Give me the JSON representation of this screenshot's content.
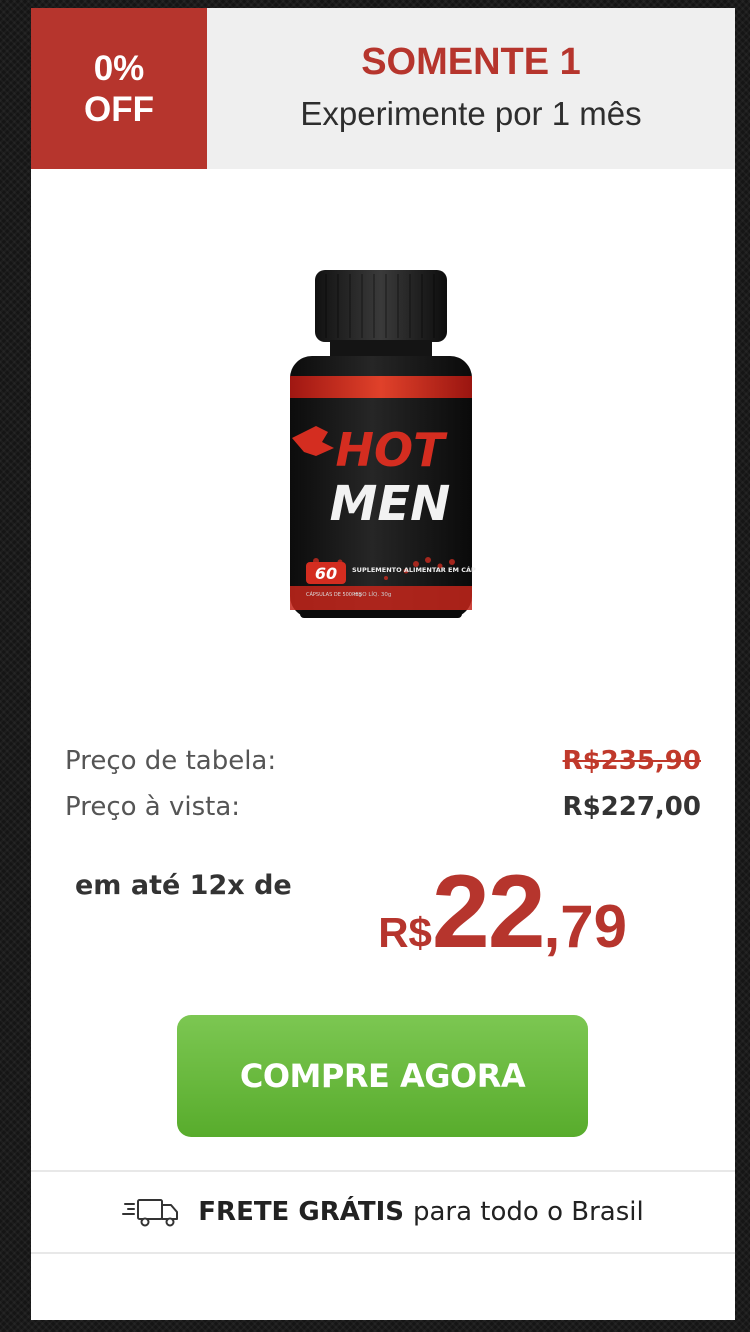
{
  "offer": {
    "discount_line1": "0%",
    "discount_line2": "OFF",
    "title": "SOMENTE 1",
    "subtitle": "Experimente por 1 mês"
  },
  "product": {
    "brand_line1": "HOT",
    "brand_line2": "MEN",
    "capsule_count": "60",
    "capsule_caption": "CÁPSULAS DE 500 mg",
    "description": "SUPLEMENTO ALIMENTAR EM CÁPSULAS",
    "net_weight": "PESO LÍQ. 30g"
  },
  "pricing": {
    "list_label": "Preço de tabela:",
    "list_value": "R$235,90",
    "cash_label": "Preço à vista:",
    "cash_value": "R$227,00",
    "installments_label": "em até 12x de",
    "installment_currency": "R$",
    "installment_int": "22",
    "installment_cents": ",79"
  },
  "cta": {
    "label": "COMPRE AGORA"
  },
  "shipping": {
    "bold": "FRETE GRÁTIS",
    "text": "para todo o Brasil",
    "icon": "truck-icon"
  },
  "colors": {
    "accent": "#b6352d",
    "button": "#6bbb3f",
    "header_bg": "#efefef"
  }
}
